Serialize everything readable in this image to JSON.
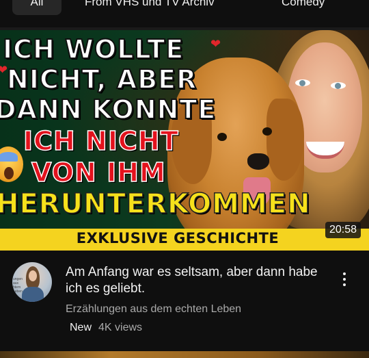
{
  "chips": [
    "All",
    "From VHS und TV Archiv",
    "Comedy"
  ],
  "thumbnail": {
    "lines": [
      {
        "text": "ICH WOLLTE",
        "style": "white"
      },
      {
        "text": "NICHT, ABER",
        "style": "white"
      },
      {
        "text": "DANN KONNTE",
        "style": "white"
      },
      {
        "text": "ICH NICHT",
        "style": "red"
      },
      {
        "text": "VON IHM",
        "style": "red"
      },
      {
        "text": "HERUNTERKOMMEN",
        "style": "yellow"
      }
    ],
    "banner": "EXKLUSIVE GESCHICHTE",
    "duration": "20:58"
  },
  "video": {
    "title": "Am Anfang war es seltsam, aber dann habe ich es geliebt.",
    "channel": "Erzählungen aus dem echten Leben",
    "badge": "New",
    "views": "4K views",
    "avatar_text": "ungen aus htem Leben"
  },
  "icons": [
    "more-vert-icon",
    "heart-icon",
    "scared-emoji-icon"
  ],
  "colors": {
    "background": "#0f0f0f",
    "banner": "#f4d31f",
    "accent_red": "#e3121d",
    "accent_yellow": "#f6e11b"
  }
}
